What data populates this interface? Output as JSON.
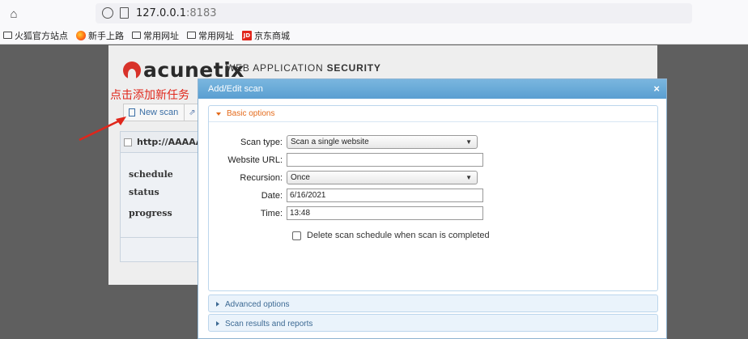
{
  "browser": {
    "url_host": "127.0.0.1",
    "url_port": ":8183",
    "bookmarks": [
      {
        "icon": "folder-icon",
        "label": "火狐官方站点"
      },
      {
        "icon": "firefox-icon",
        "label": "新手上路"
      },
      {
        "icon": "folder-icon",
        "label": "常用网址"
      },
      {
        "icon": "folder-icon",
        "label": "常用网址"
      },
      {
        "icon": "jd-icon",
        "label": "京东商城"
      }
    ]
  },
  "page": {
    "logo_text": "acunetix",
    "logo_sub_light": "WEB APPLICATION",
    "logo_sub_bold": "SECURITY",
    "new_scan_label": "New scan",
    "annotation": "点击添加新任务",
    "scan_target": "http://AAAAA",
    "info": [
      "schedule",
      "status",
      "progress"
    ]
  },
  "dialog": {
    "title": "Add/Edit scan",
    "basic_label": "Basic options",
    "advanced_label": "Advanced options",
    "results_label": "Scan results and reports",
    "fields": {
      "scan_type_label": "Scan type:",
      "scan_type_value": "Scan a single website",
      "website_url_label": "Website URL:",
      "website_url_value": "",
      "recursion_label": "Recursion:",
      "recursion_value": "Once",
      "date_label": "Date:",
      "date_value": "6/16/2021",
      "time_label": "Time:",
      "time_value": "13:48"
    },
    "delete_checkbox_label": "Delete scan schedule when scan is completed",
    "delete_checked": false
  },
  "colors": {
    "accent_orange": "#e46a1a",
    "title_blue": "#5a9fd1",
    "annotation_red": "#e0261b",
    "logo_red": "#d8322a"
  }
}
